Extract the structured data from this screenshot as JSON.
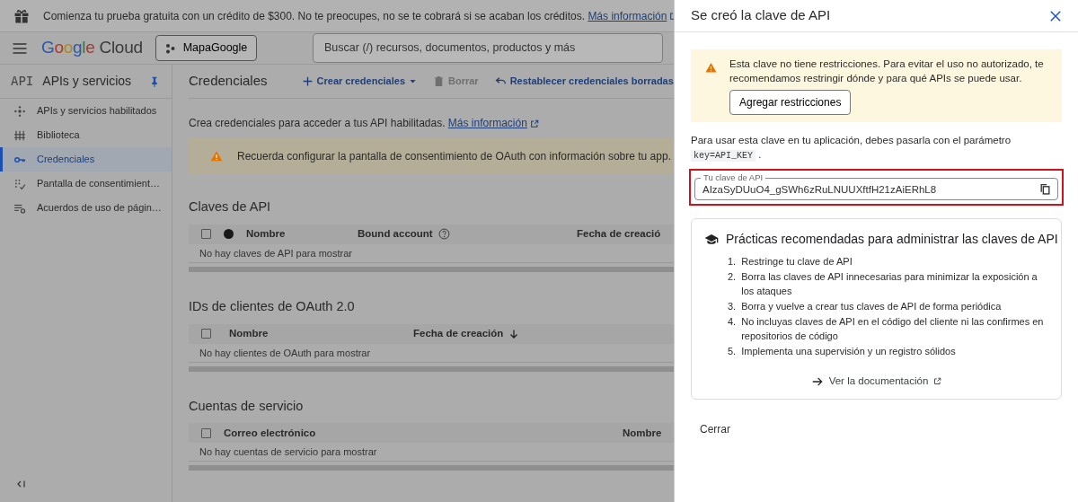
{
  "banner": {
    "text": "Comienza tu prueba gratuita con un crédito de $300. No te preocupes, no se te cobrará si se acaban los créditos.",
    "link": "Más información"
  },
  "header": {
    "logo": "Google Cloud",
    "project": "MapaGoogle",
    "search": {
      "placeholder": "Buscar (/) recursos, documentos, productos y más"
    }
  },
  "sidebar": {
    "badge": "API",
    "title": "APIs y servicios",
    "items": [
      {
        "label": "APIs y servicios habilitados",
        "selected": false
      },
      {
        "label": "Biblioteca",
        "selected": false
      },
      {
        "label": "Credenciales",
        "selected": true
      },
      {
        "label": "Pantalla de consentimient…",
        "selected": false
      },
      {
        "label": "Acuerdos de uso de págin…",
        "selected": false
      }
    ]
  },
  "toolbar": {
    "title": "Credenciales",
    "actions": [
      {
        "label": "Crear credenciales",
        "kind": "create",
        "disabled": false
      },
      {
        "label": "Borrar",
        "kind": "delete",
        "disabled": true
      },
      {
        "label": "Restablecer credenciales borradas",
        "kind": "restore",
        "disabled": false
      }
    ]
  },
  "intro": {
    "text": "Crea credenciales para acceder a tus API habilitadas.",
    "link": "Más información"
  },
  "notice": "Recuerda configurar la pantalla de consentimiento de OAuth con información sobre tu app.",
  "sections": [
    {
      "title": "Claves de API",
      "columns": [
        {
          "kind": "checkbox",
          "checked": false
        },
        {
          "kind": "dot"
        },
        {
          "kind": "text",
          "label": "Nombre"
        },
        {
          "kind": "help",
          "label": "Bound account"
        },
        {
          "kind": "text",
          "label": "Fecha de creació"
        }
      ],
      "empty": "No hay claves de API para mostrar"
    },
    {
      "title": "IDs de clientes de OAuth 2.0",
      "columns": [
        {
          "kind": "checkbox",
          "checked": false
        },
        {
          "kind": "text",
          "label": "Nombre"
        },
        {
          "kind": "sort",
          "label": "Fecha de creación"
        }
      ],
      "empty": "No hay clientes de OAuth para mostrar"
    },
    {
      "title": "Cuentas de servicio",
      "columns": [
        {
          "kind": "checkbox",
          "checked": false
        },
        {
          "kind": "text",
          "label": "Correo electrónico"
        },
        {
          "kind": "sortcut",
          "label": "Nombre"
        }
      ],
      "empty": "No hay cuentas de servicio para mostrar"
    }
  ],
  "drawer": {
    "title": "Se creó la clave de API",
    "warning": {
      "text": "Esta clave no tiene restricciones. Para evitar el uso no autorizado, te recomendamos restringir dónde y para qué APIs se puede usar.",
      "button": "Agregar restricciones"
    },
    "usage": {
      "text": "Para usar esta clave en tu aplicación, debes pasarla con el parámetro",
      "code": "key=API_KEY",
      "after": "."
    },
    "key_field": {
      "label": "Tu clave de API",
      "value": "AIzaSyDUuO4_gSWh6zRuLNUUXftfH21zAiERhL8"
    },
    "practices": {
      "title": "Prácticas recomendadas para administrar las claves de API",
      "items": [
        {
          "number": "1.",
          "text": "Restringe tu clave de API"
        },
        {
          "number": "2.",
          "text": "Borra las claves de API innecesarias para minimizar la exposición a los ataques"
        },
        {
          "number": "3.",
          "text": "Borra y vuelve a crear tus claves de API de forma periódica"
        },
        {
          "number": "4.",
          "text": "No incluyas claves de API en el código del cliente ni las confirmes en repositorios de código"
        },
        {
          "number": "5.",
          "text": "Implementa una supervisión y un registro sólidos"
        }
      ],
      "link": "Ver la documentación"
    },
    "close": "Cerrar"
  }
}
